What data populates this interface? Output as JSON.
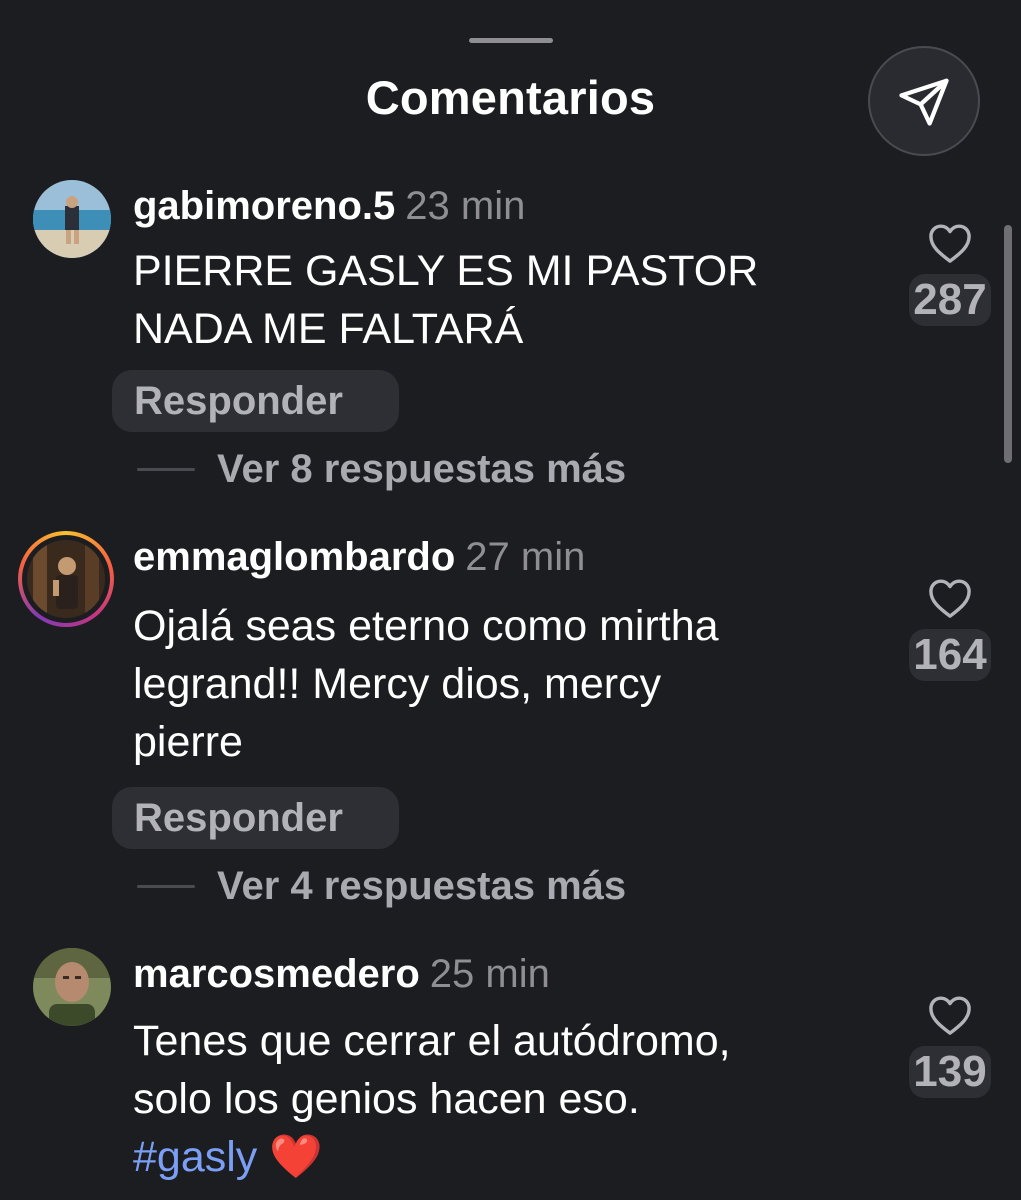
{
  "header": {
    "title": "Comentarios"
  },
  "icons": {
    "share": "paper-plane-icon",
    "like": "heart-outline-icon"
  },
  "comments": [
    {
      "username": "gabimoreno.5",
      "time": "23 min",
      "text_lines": [
        "PIERRE GASLY ES MI PASTOR",
        "NADA ME FALTARÁ"
      ],
      "reply_label": "Responder",
      "view_replies": "Ver 8 respuestas más",
      "likes": "287"
    },
    {
      "username": "emmaglombardo",
      "time": "27 min",
      "text_lines": [
        "Ojalá seas eterno como mirtha",
        "legrand!! Mercy dios, mercy",
        "pierre"
      ],
      "reply_label": "Responder",
      "view_replies": "Ver 4 respuestas más",
      "likes": "164"
    },
    {
      "username": "marcosmedero",
      "time": "25 min",
      "text_lines": [
        "Tenes que cerrar el autódromo,",
        "solo los genios hacen eso."
      ],
      "hashtag": "#gasly",
      "emoji": "❤️",
      "likes": "139"
    }
  ]
}
